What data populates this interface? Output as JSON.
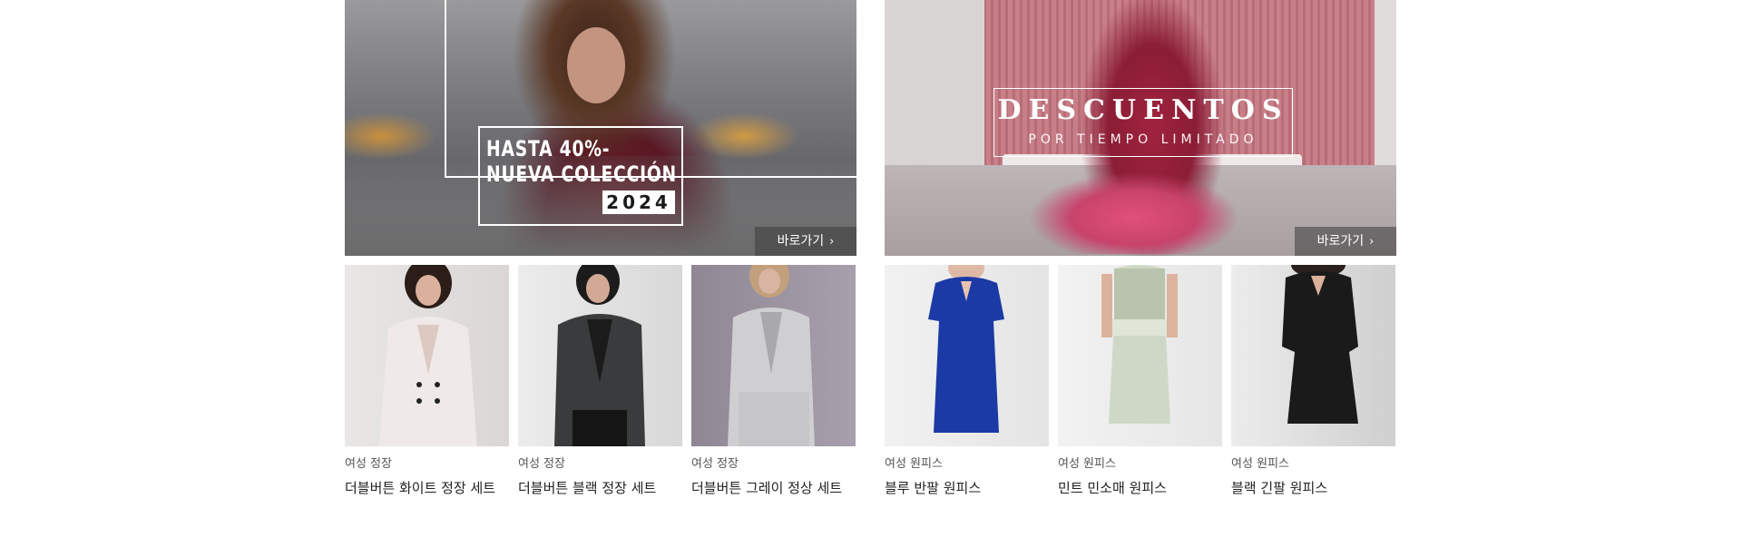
{
  "left_banner": {
    "promo_line1": "HASTA 40%-",
    "promo_line2": "NUEVA COLECCIÓN",
    "promo_year": "2024",
    "button_label": "바로가기",
    "button_icon": "chevron-right-icon"
  },
  "right_banner": {
    "title": "DESCUENTOS",
    "subtitle": "POR TIEMPO LIMITADO",
    "button_label": "바로가기",
    "button_icon": "chevron-right-icon"
  },
  "left_products": [
    {
      "category": "여성 정장",
      "name": "더블버튼 화이트 정장 세트"
    },
    {
      "category": "여성 정장",
      "name": "더블버튼 블랙 정장 세트"
    },
    {
      "category": "여성 정장",
      "name": "더블버튼 그레이 정상 세트"
    }
  ],
  "right_products": [
    {
      "category": "여성 원피스",
      "name": "블루 반팔 원피스"
    },
    {
      "category": "여성 원피스",
      "name": "민트 민소매 원피스"
    },
    {
      "category": "여성 원피스",
      "name": "블랙 긴팔 원피스"
    }
  ],
  "colors": {
    "button_overlay": "#3c3c3c",
    "text_primary": "#222222",
    "text_secondary": "#555555"
  }
}
